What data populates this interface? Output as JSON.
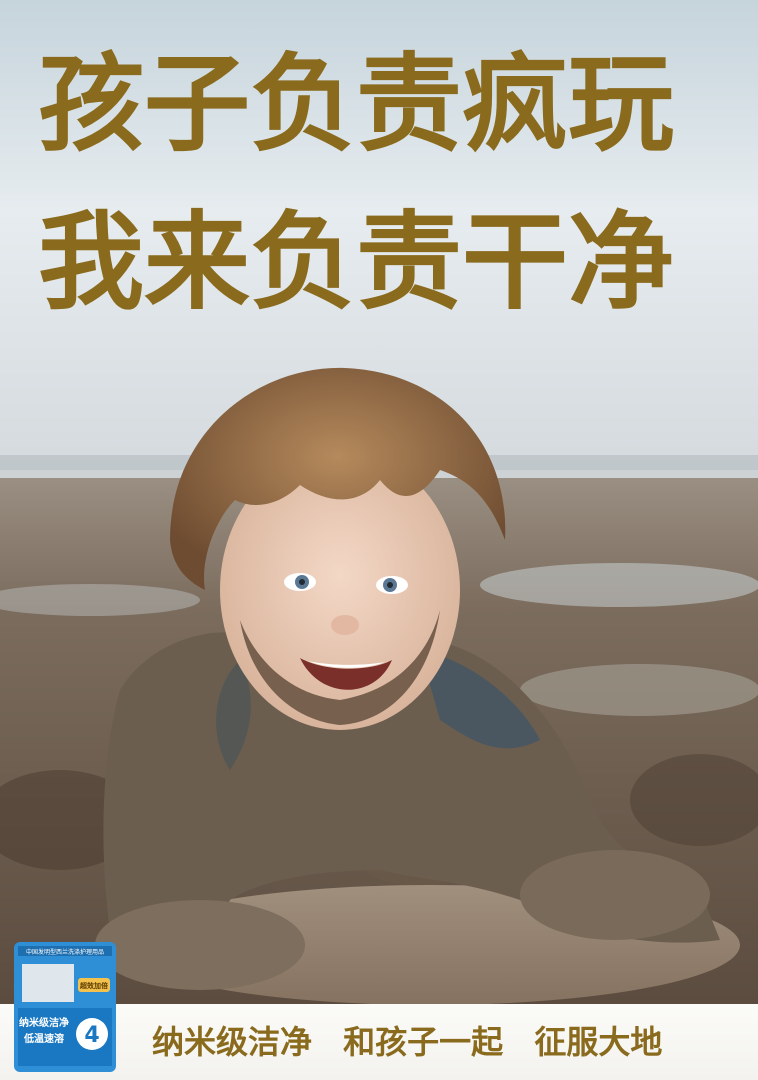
{
  "headline": {
    "line1": "孩子负责疯玩",
    "line2": "我来负责干净"
  },
  "slogan": {
    "part1": "纳米级洁净",
    "part2": "和孩子一起",
    "part3": "征服大地"
  },
  "product_pack": {
    "banner_text": "中国发明型西兰洗涤护理用品",
    "badge_text": "超效加倍",
    "main_text_1": "纳米级洁净",
    "main_text_2": "低温速溶",
    "number": "4"
  },
  "colors": {
    "headline": "#8a6b1e",
    "sky_top": "#c9d6de",
    "mud": "#6f5f4e",
    "pack_blue": "#2f8fd6"
  }
}
